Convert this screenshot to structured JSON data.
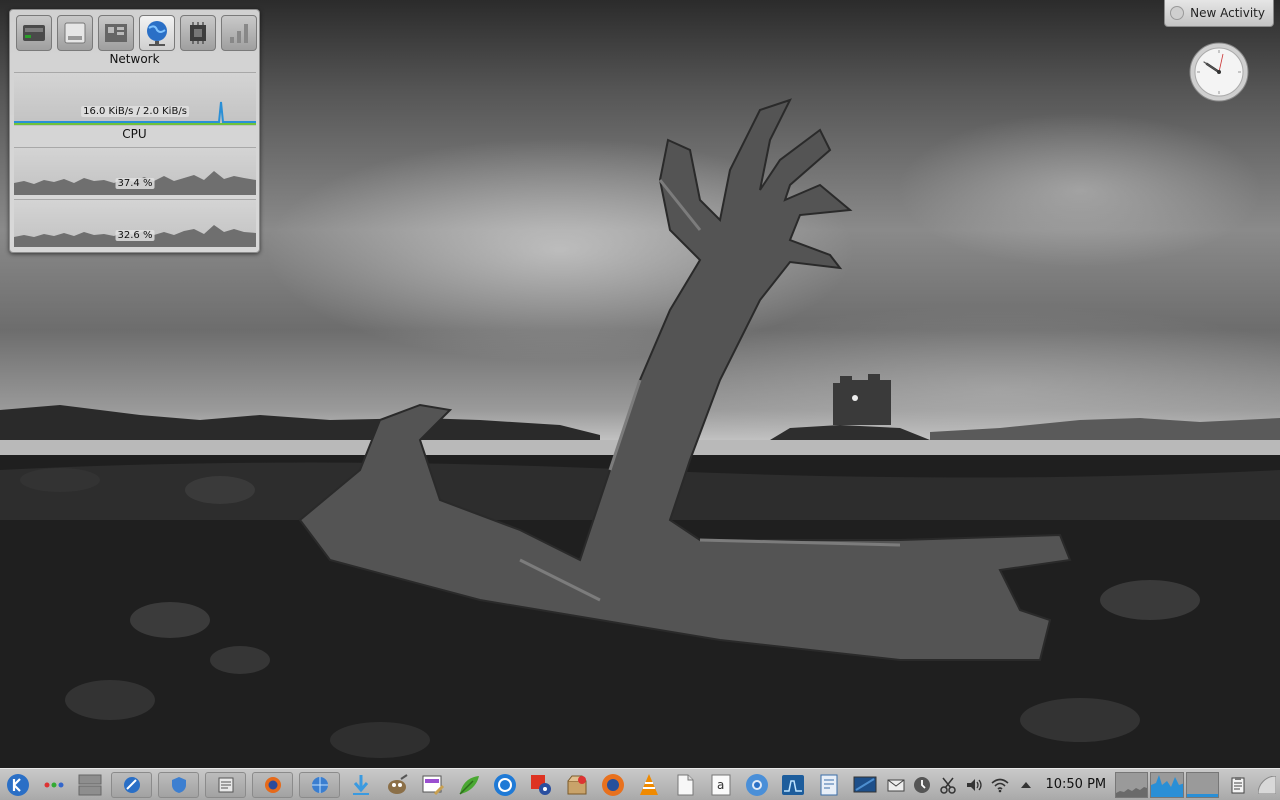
{
  "system_monitor": {
    "tabs": [
      "hard-disk-icon",
      "storage-icon",
      "hardware-icon",
      "network-icon",
      "cpu-chip-icon",
      "signal-bars-icon"
    ],
    "active_tab": "network-icon",
    "network": {
      "title": "Network",
      "rate": "16.0 KiB/s / 2.0 KiB/s",
      "colors": {
        "download": "#2a8fd6",
        "upload": "#6fc23a"
      }
    },
    "cpu": {
      "title": "CPU",
      "cores": [
        {
          "usage": "37.4 %",
          "value": 0.374
        },
        {
          "usage": "32.6 %",
          "value": 0.326
        }
      ]
    }
  },
  "desktop": {
    "new_activity_label": "New Activity",
    "clock_widget_icon": "analog-clock-icon"
  },
  "panel": {
    "launcher_icon": "kde-kickoff-icon",
    "pager_icon": "activity-pager-icon",
    "window_list_icon": "desktop-pager-icon",
    "tasks": [
      "konqueror-task-icon",
      "browser-task-icon",
      "file-manager-task-icon",
      "firefox-task-icon",
      "globe-task-icon"
    ],
    "quick_launch": [
      "download-icon",
      "gimp-icon",
      "image-editor-icon",
      "gnome-leaf-icon",
      "web-browser-icon",
      "settings-tool-icon",
      "package-installer-icon",
      "firefox-icon",
      "vlc-icon",
      "document-icon",
      "text-editor-icon",
      "chromium-icon",
      "monitor-graph-icon",
      "text-file-icon",
      "desktop-icon"
    ],
    "tray": [
      "mail-icon",
      "system-update-icon",
      "scissors-icon",
      "volume-icon",
      "wifi-icon",
      "tray-expand-icon"
    ],
    "clock": "10:50 PM",
    "end_icon": "clipboard-icon",
    "accent": "#2a8fd6"
  }
}
